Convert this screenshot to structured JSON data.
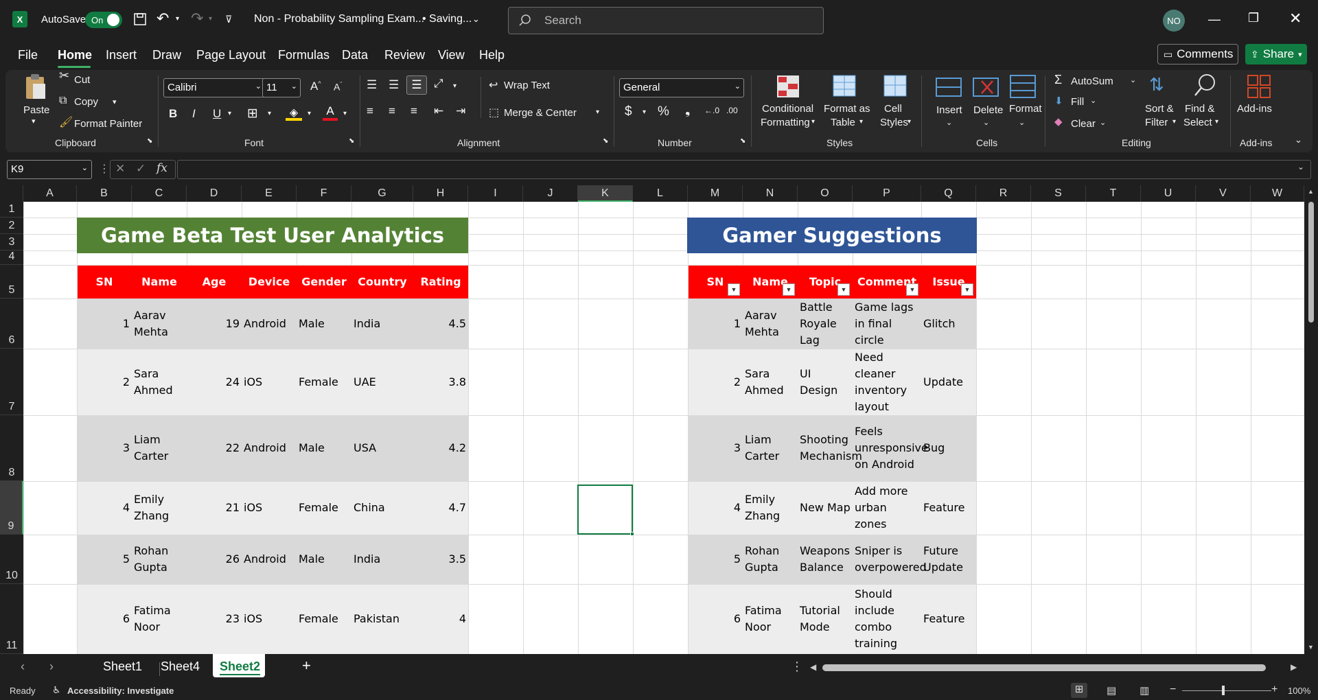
{
  "titlebar": {
    "autosave_label": "AutoSave",
    "toggle_label": "On",
    "doc_title": "Non - Probability Sampling Exam...",
    "saving": "• Saving...",
    "search_placeholder": "Search",
    "avatar": "NO"
  },
  "menu": [
    "File",
    "Home",
    "Insert",
    "Draw",
    "Page Layout",
    "Formulas",
    "Data",
    "Review",
    "View",
    "Help"
  ],
  "menu_right": {
    "comments": "Comments",
    "share": "Share"
  },
  "ribbon": {
    "clipboard": {
      "paste": "Paste",
      "cut": "Cut",
      "copy": "Copy",
      "format_painter": "Format Painter",
      "label": "Clipboard"
    },
    "font": {
      "name": "Calibri",
      "size": "11",
      "label": "Font"
    },
    "alignment": {
      "wrap": "Wrap Text",
      "merge": "Merge & Center",
      "label": "Alignment"
    },
    "number": {
      "format": "General",
      "label": "Number"
    },
    "styles": {
      "cond1": "Conditional",
      "cond2": "Formatting",
      "fat1": "Format as",
      "fat2": "Table",
      "cs1": "Cell",
      "cs2": "Styles",
      "label": "Styles"
    },
    "cells": {
      "insert": "Insert",
      "delete": "Delete",
      "format": "Format",
      "label": "Cells"
    },
    "editing": {
      "autosum": "AutoSum",
      "fill": "Fill",
      "clear": "Clear",
      "sort1": "Sort &",
      "sort2": "Filter",
      "find1": "Find &",
      "find2": "Select",
      "label": "Editing"
    },
    "addins": {
      "btn": "Add-ins",
      "label": "Add-ins"
    }
  },
  "formula_bar": {
    "name_box": "K9",
    "fx": "fx"
  },
  "columns": [
    "A",
    "B",
    "C",
    "D",
    "E",
    "F",
    "G",
    "H",
    "I",
    "J",
    "K",
    "L",
    "M",
    "N",
    "O",
    "P",
    "Q",
    "R",
    "S",
    "T",
    "U",
    "V",
    "W"
  ],
  "rows": [
    "1",
    "2",
    "3",
    "4",
    "5",
    "6",
    "7",
    "8",
    "9",
    "10",
    "11"
  ],
  "table1": {
    "title": "Game Beta Test User Analytics",
    "headers": [
      "SN",
      "Name",
      "Age",
      "Device",
      "Gender",
      "Country",
      "Rating"
    ],
    "rows": [
      [
        "1",
        "Aarav Mehta",
        "19",
        "Android",
        "Male",
        "India",
        "4.5"
      ],
      [
        "2",
        "Sara Ahmed",
        "24",
        "iOS",
        "Female",
        "UAE",
        "3.8"
      ],
      [
        "3",
        "Liam Carter",
        "22",
        "Android",
        "Male",
        "USA",
        "4.2"
      ],
      [
        "4",
        "Emily Zhang",
        "21",
        "iOS",
        "Female",
        "China",
        "4.7"
      ],
      [
        "5",
        "Rohan Gupta",
        "26",
        "Android",
        "Male",
        "India",
        "3.5"
      ],
      [
        "6",
        "Fatima Noor",
        "23",
        "iOS",
        "Female",
        "Pakistan",
        "4"
      ]
    ]
  },
  "table2": {
    "title": "Gamer Suggestions",
    "headers": [
      "SN",
      "Name",
      "Topic",
      "Comment",
      "Issue"
    ],
    "rows": [
      [
        "1",
        "Aarav Mehta",
        "Battle Royale Lag",
        "Game lags in final circle",
        "Glitch"
      ],
      [
        "2",
        "Sara Ahmed",
        "UI Design",
        "Need cleaner inventory layout",
        "Update"
      ],
      [
        "3",
        "Liam Carter",
        "Shooting Mechanism",
        "Feels unresponsive on Android",
        "Bug"
      ],
      [
        "4",
        "Emily Zhang",
        "New Map",
        "Add more urban zones",
        "Feature"
      ],
      [
        "5",
        "Rohan Gupta",
        "Weapons Balance",
        "Sniper is overpowered",
        "Future Update"
      ],
      [
        "6",
        "Fatima Noor",
        "Tutorial Mode",
        "Should include combo training",
        "Feature"
      ]
    ]
  },
  "tabs": [
    "Sheet1",
    "Sheet4",
    "Sheet2"
  ],
  "status": {
    "ready": "Ready",
    "accessibility": "Accessibility: Investigate",
    "zoom": "100%"
  },
  "colors": {
    "green_banner": "#548235",
    "blue_banner": "#2f5597",
    "header_red": "#ff0000",
    "band_dark": "#d9d9d9",
    "band_light": "#ededed",
    "excel_green": "#107c41"
  }
}
